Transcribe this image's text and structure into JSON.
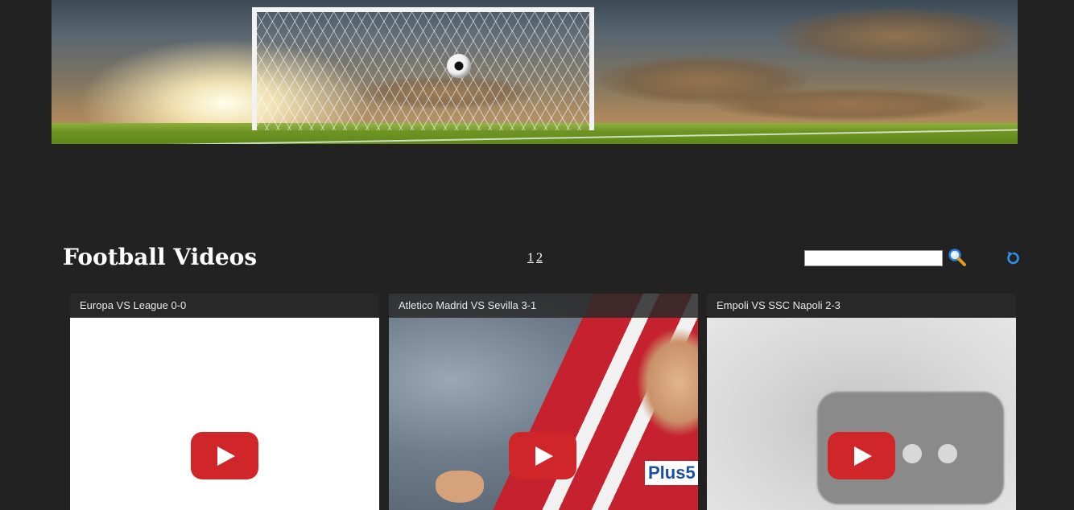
{
  "header": {
    "title": "Football Videos",
    "pages": [
      "1",
      "2"
    ]
  },
  "search": {
    "value": "",
    "placeholder": ""
  },
  "icons": {
    "search": "magnifier-icon",
    "refresh": "refresh-icon",
    "play": "youtube-play-icon"
  },
  "colors": {
    "background": "#222222",
    "youtube_red": "#d0262a",
    "refresh_blue": "#2f8fe8"
  },
  "videos": [
    {
      "title": "Europa VS League 0-0"
    },
    {
      "title": "Atletico Madrid VS Sevilla 3-1",
      "sponsor": "Plus5"
    },
    {
      "title": "Empoli VS SSC Napoli 2-3"
    }
  ]
}
